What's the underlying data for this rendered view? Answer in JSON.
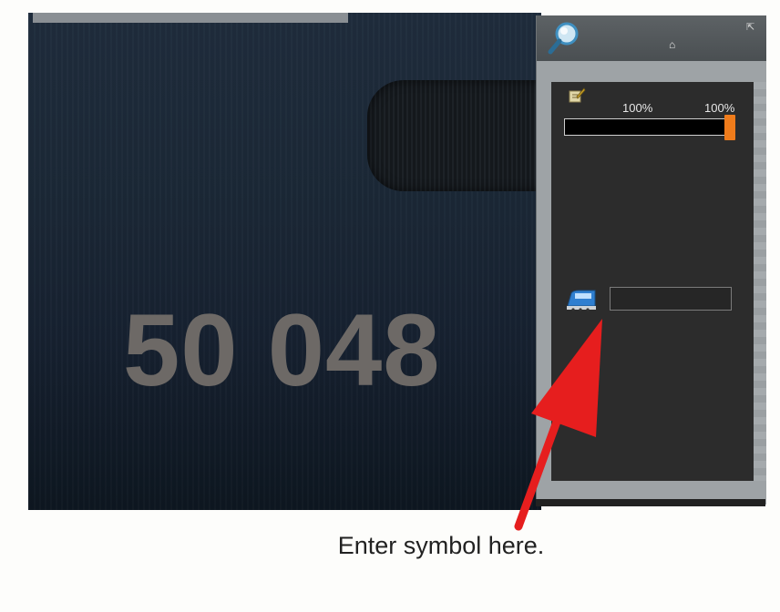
{
  "viewport": {
    "locomotive_number": "50 048"
  },
  "side_panel": {
    "header_glyph": "⌂",
    "progress": {
      "left_label": "100%",
      "right_label": "100%",
      "value_fraction": 1.0
    },
    "symbol_input": {
      "value": "",
      "placeholder": "",
      "cursor_glyph": "‹"
    },
    "icons": {
      "search": "search-icon",
      "edit": "edit-icon",
      "train": "train-icon",
      "expand": "expand-icon"
    }
  },
  "annotation": {
    "caption": "Enter symbol here.",
    "arrow_color": "#e61e1e"
  }
}
